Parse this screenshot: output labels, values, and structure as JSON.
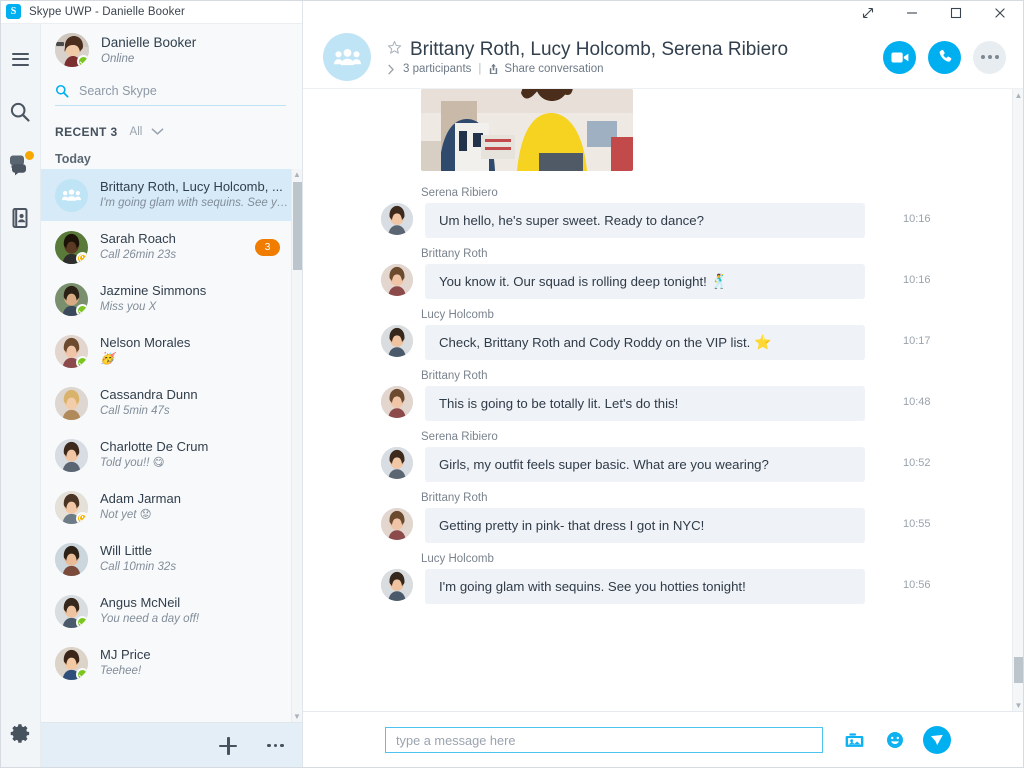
{
  "window": {
    "app_title": "Skype UWP - Danielle Booker",
    "logo_letter": "S",
    "controls": {
      "restore": "restore-icon",
      "minimize": "minimize-icon",
      "maximize": "maximize-icon",
      "close": "close-icon"
    }
  },
  "colors": {
    "accent": "#00aff0",
    "selected_row": "#d6eaf7",
    "bubble": "#eff2f7",
    "unread_badge": "#f07c00",
    "presence_online": "#7bc61e",
    "presence_away": "#f7b500",
    "group_avatar": "#bfe4f6"
  },
  "rail": {
    "items": [
      {
        "name": "menu-icon",
        "label": "Menu"
      },
      {
        "name": "search-icon",
        "label": "Search"
      },
      {
        "name": "chat-icon",
        "label": "Chats",
        "badge": true
      },
      {
        "name": "contacts-icon",
        "label": "Contacts"
      }
    ],
    "settings": {
      "name": "gear-icon",
      "label": "Settings"
    }
  },
  "profile": {
    "name": "Danielle Booker",
    "status": "Online",
    "presence": "online"
  },
  "search": {
    "placeholder": "Search Skype",
    "value": "",
    "icon": "search-icon"
  },
  "recent": {
    "label": "RECENT 3",
    "filter": "All",
    "chevron": "chevron-down-icon",
    "day_label": "Today"
  },
  "conversations": [
    {
      "name": "Brittany Roth, Lucy Holcomb, ...",
      "preview": "I'm going glam with sequins. See you ...",
      "type": "group",
      "selected": true,
      "presence": "",
      "unread": ""
    },
    {
      "name": "Sarah Roach",
      "preview": "Call 26min 23s",
      "type": "person",
      "selected": false,
      "presence": "away",
      "unread": "3"
    },
    {
      "name": "Jazmine Simmons",
      "preview": "Miss you X",
      "type": "person",
      "selected": false,
      "presence": "online",
      "unread": ""
    },
    {
      "name": "Nelson Morales",
      "preview": "🥳",
      "type": "person",
      "selected": false,
      "presence": "online",
      "unread": ""
    },
    {
      "name": "Cassandra Dunn",
      "preview": "Call 5min 47s",
      "type": "person",
      "selected": false,
      "presence": "",
      "unread": ""
    },
    {
      "name": "Charlotte De Crum",
      "preview": "Told you!! 😋",
      "type": "person",
      "selected": false,
      "presence": "",
      "unread": ""
    },
    {
      "name": "Adam Jarman",
      "preview": "Not yet 😟",
      "type": "person",
      "selected": false,
      "presence": "away",
      "unread": ""
    },
    {
      "name": "Will Little",
      "preview": "Call 10min 32s",
      "type": "person",
      "selected": false,
      "presence": "",
      "unread": ""
    },
    {
      "name": "Angus McNeil",
      "preview": "You need a day off!",
      "type": "person",
      "selected": false,
      "presence": "online",
      "unread": ""
    },
    {
      "name": "MJ Price",
      "preview": "Teehee!",
      "type": "person",
      "selected": false,
      "presence": "online",
      "unread": ""
    }
  ],
  "left_bottom": {
    "new_label": "new-conversation-button",
    "more_label": "more-options-button"
  },
  "chat_header": {
    "title": "Brittany Roth, Lucy Holcomb, Serena Ribiero",
    "participants": "3 participants",
    "separator": "|",
    "share": "Share conversation",
    "favorite_icon": "star-icon",
    "expand_icon": "chevron-right-icon",
    "share_icon": "share-icon",
    "actions": [
      {
        "name": "video-call-button",
        "icon": "video-camera-icon"
      },
      {
        "name": "audio-call-button",
        "icon": "phone-icon"
      },
      {
        "name": "more-options-button",
        "icon": "ellipsis-icon"
      }
    ]
  },
  "messages": [
    {
      "author": "Serena Ribiero",
      "text": "Um hello, he's super sweet. Ready to dance?",
      "time": "10:16",
      "emoji": ""
    },
    {
      "author": "Brittany Roth",
      "text": "You know it. Our squad is rolling deep tonight!",
      "time": "10:16",
      "emoji": "🕺"
    },
    {
      "author": "Lucy Holcomb",
      "text": "Check, Brittany Roth and Cody Roddy on the VIP list.",
      "time": "10:17",
      "emoji": "⭐"
    },
    {
      "author": "Brittany Roth",
      "text": "This is going to be totally lit. Let's do this!",
      "time": "10:48",
      "emoji": ""
    },
    {
      "author": "Serena Ribiero",
      "text": "Girls, my outfit feels super basic. What are you wearing?",
      "time": "10:52",
      "emoji": ""
    },
    {
      "author": "Brittany Roth",
      "text": "Getting pretty in pink- that dress I got in NYC!",
      "time": "10:55",
      "emoji": ""
    },
    {
      "author": "Lucy Holcomb",
      "text": "I'm going glam with sequins. See you hotties tonight!",
      "time": "10:56",
      "emoji": ""
    }
  ],
  "composer": {
    "placeholder": "type a message here",
    "value": "",
    "buttons": [
      {
        "name": "add-photo-button",
        "icon": "photo-icon"
      },
      {
        "name": "emoji-button",
        "icon": "smiley-icon"
      },
      {
        "name": "send-button",
        "icon": "send-icon"
      }
    ]
  }
}
